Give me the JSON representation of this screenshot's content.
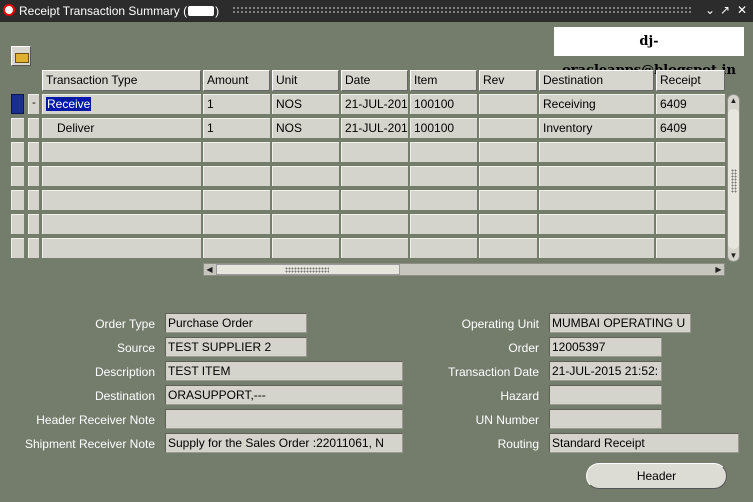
{
  "window": {
    "title": "Receipt Transaction Summary (",
    "title_suffix": ")"
  },
  "watermark": "dj-oracleapps@blogspot.in",
  "table": {
    "columns": [
      "Transaction Type",
      "Amount",
      "Unit",
      "Date",
      "Item",
      "Rev",
      "Destination",
      "Receipt"
    ],
    "rows": [
      {
        "expander": "-",
        "type": "Receive",
        "amount": "1",
        "unit": "NOS",
        "date": "21-JUL-201",
        "item": "100100",
        "rev": "",
        "destination": "Receiving",
        "receipt": "6409"
      },
      {
        "expander": "",
        "type": "Deliver",
        "amount": "1",
        "unit": "NOS",
        "date": "21-JUL-201",
        "item": "100100",
        "rev": "",
        "destination": "Inventory",
        "receipt": "6409"
      }
    ]
  },
  "details": {
    "order_type": {
      "label": "Order Type",
      "value": "Purchase Order"
    },
    "source": {
      "label": "Source",
      "value": "TEST SUPPLIER 2"
    },
    "description": {
      "label": "Description",
      "value": "TEST ITEM"
    },
    "destination": {
      "label": "Destination",
      "value": "ORASUPPORT,---"
    },
    "header_receiver_note": {
      "label": "Header Receiver Note",
      "value": ""
    },
    "shipment_receiver_note": {
      "label": "Shipment Receiver Note",
      "value": "Supply for the Sales Order :22011061, N"
    },
    "operating_unit": {
      "label": "Operating Unit",
      "value": "MUMBAI OPERATING U"
    },
    "order": {
      "label": "Order",
      "value": "12005397"
    },
    "transaction_date": {
      "label": "Transaction Date",
      "value": "21-JUL-2015 21:52:"
    },
    "hazard": {
      "label": "Hazard",
      "value": ""
    },
    "un_number": {
      "label": "UN Number",
      "value": ""
    },
    "routing": {
      "label": "Routing",
      "value": "Standard Receipt"
    }
  },
  "buttons": {
    "header": "Header"
  },
  "icons": {
    "window": "oracle-icon",
    "toolbar": "folder-open-icon"
  },
  "colors": {
    "background": "#747c6c",
    "selection": "#0018a8",
    "titlebar": "#2c2c2c"
  }
}
